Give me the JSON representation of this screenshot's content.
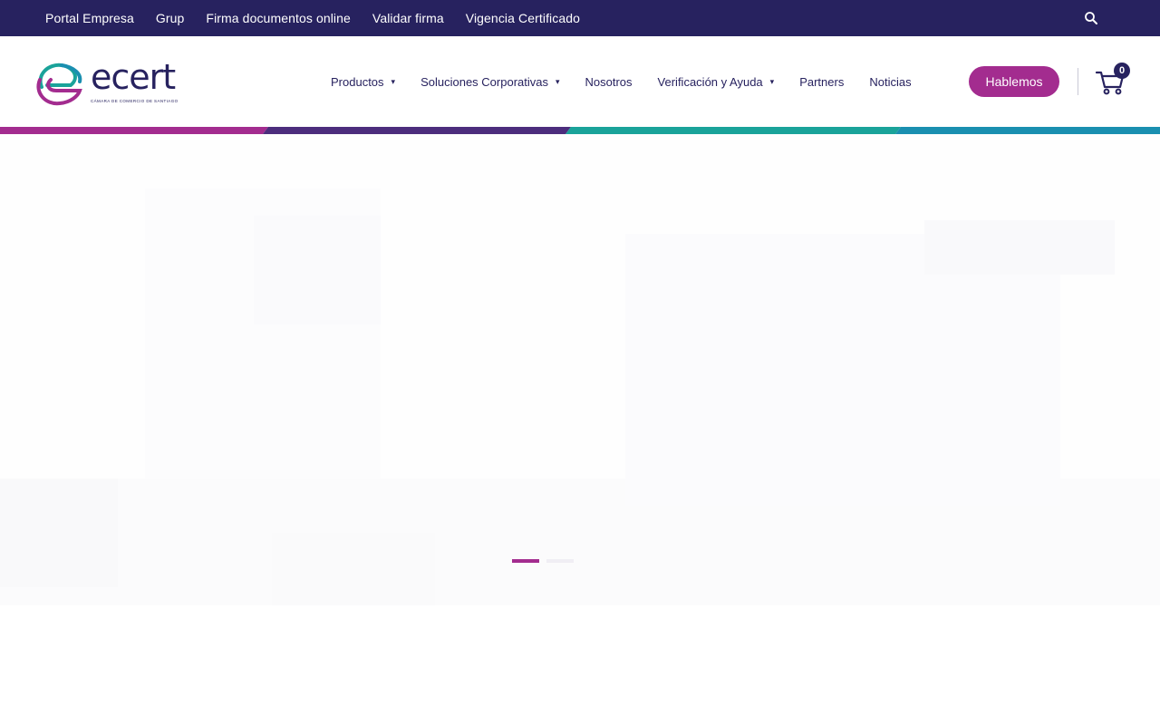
{
  "topbar": {
    "links": [
      {
        "label": "Portal Empresa"
      },
      {
        "label": "Grup"
      },
      {
        "label": "Firma documentos online"
      },
      {
        "label": "Validar firma"
      },
      {
        "label": "Vigencia Certificado"
      }
    ],
    "search_icon": "search-icon"
  },
  "header": {
    "logo": {
      "word": "ecert",
      "tagline": "CÁMARA DE COMERCIO DE SANTIAGO"
    },
    "nav": [
      {
        "label": "Productos",
        "has_dropdown": true
      },
      {
        "label": "Soluciones Corporativas",
        "has_dropdown": true
      },
      {
        "label": "Nosotros",
        "has_dropdown": false
      },
      {
        "label": "Verificación y Ayuda",
        "has_dropdown": true
      },
      {
        "label": "Partners",
        "has_dropdown": false
      },
      {
        "label": "Noticias",
        "has_dropdown": false
      }
    ],
    "cta_label": "Hablemos",
    "cart": {
      "icon": "cart-icon",
      "count": "0"
    }
  },
  "hero": {
    "kicker": "",
    "headline": "",
    "subline": "",
    "slides_total": 2,
    "active_slide": 1
  },
  "colors": {
    "topbar_bg": "#27225f",
    "brand_navy": "#27225f",
    "brand_magenta": "#a32c8f",
    "strip": [
      "#a32c8f",
      "#4c2d7d",
      "#1aa39a",
      "#1a8fb0"
    ]
  }
}
